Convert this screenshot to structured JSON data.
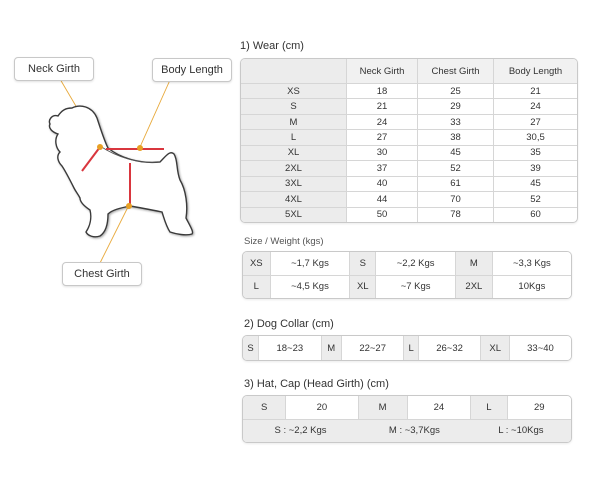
{
  "diagram": {
    "labels": {
      "neck_girth": "Neck Girth",
      "body_length": "Body Length",
      "chest_girth": "Chest Girth"
    },
    "colors": {
      "measure_line": "#d9363e",
      "pointer_line": "#e8a93a",
      "pointer_dot": "#e8a024"
    }
  },
  "wear": {
    "title": "1) Wear (cm)",
    "headers": [
      "",
      "Neck Girth",
      "Chest Girth",
      "Body Length"
    ],
    "rows": [
      {
        "size": "XS",
        "neck": "18",
        "chest": "25",
        "body": "21"
      },
      {
        "size": "S",
        "neck": "21",
        "chest": "29",
        "body": "24"
      },
      {
        "size": "M",
        "neck": "24",
        "chest": "33",
        "body": "27"
      },
      {
        "size": "L",
        "neck": "27",
        "chest": "38",
        "body": "30,5"
      },
      {
        "size": "XL",
        "neck": "30",
        "chest": "45",
        "body": "35"
      },
      {
        "size": "2XL",
        "neck": "37",
        "chest": "52",
        "body": "39"
      },
      {
        "size": "3XL",
        "neck": "40",
        "chest": "61",
        "body": "45"
      },
      {
        "size": "4XL",
        "neck": "44",
        "chest": "70",
        "body": "52"
      },
      {
        "size": "5XL",
        "neck": "50",
        "chest": "78",
        "body": "60"
      }
    ]
  },
  "size_weight": {
    "title": "Size / Weight (kgs)",
    "rows": [
      [
        {
          "size": "XS",
          "weight": "~1,7 Kgs"
        },
        {
          "size": "S",
          "weight": "~2,2 Kgs"
        },
        {
          "size": "M",
          "weight": "~3,3 Kgs"
        }
      ],
      [
        {
          "size": "L",
          "weight": "~4,5 Kgs"
        },
        {
          "size": "XL",
          "weight": "~7 Kgs"
        },
        {
          "size": "2XL",
          "weight": "10Kgs"
        }
      ]
    ]
  },
  "collar": {
    "title": "2) Dog Collar (cm)",
    "items": [
      {
        "size": "S",
        "range": "18~23"
      },
      {
        "size": "M",
        "range": "22~27"
      },
      {
        "size": "L",
        "range": "26~32"
      },
      {
        "size": "XL",
        "range": "33~40"
      }
    ]
  },
  "hat": {
    "title": "3) Hat, Cap (Head Girth) (cm)",
    "items": [
      {
        "size": "S",
        "value": "20"
      },
      {
        "size": "M",
        "value": "24"
      },
      {
        "size": "L",
        "value": "29"
      }
    ],
    "weights": [
      "S : ~2,2 Kgs",
      "M : ~3,7Kgs",
      "L : ~10Kgs"
    ]
  }
}
